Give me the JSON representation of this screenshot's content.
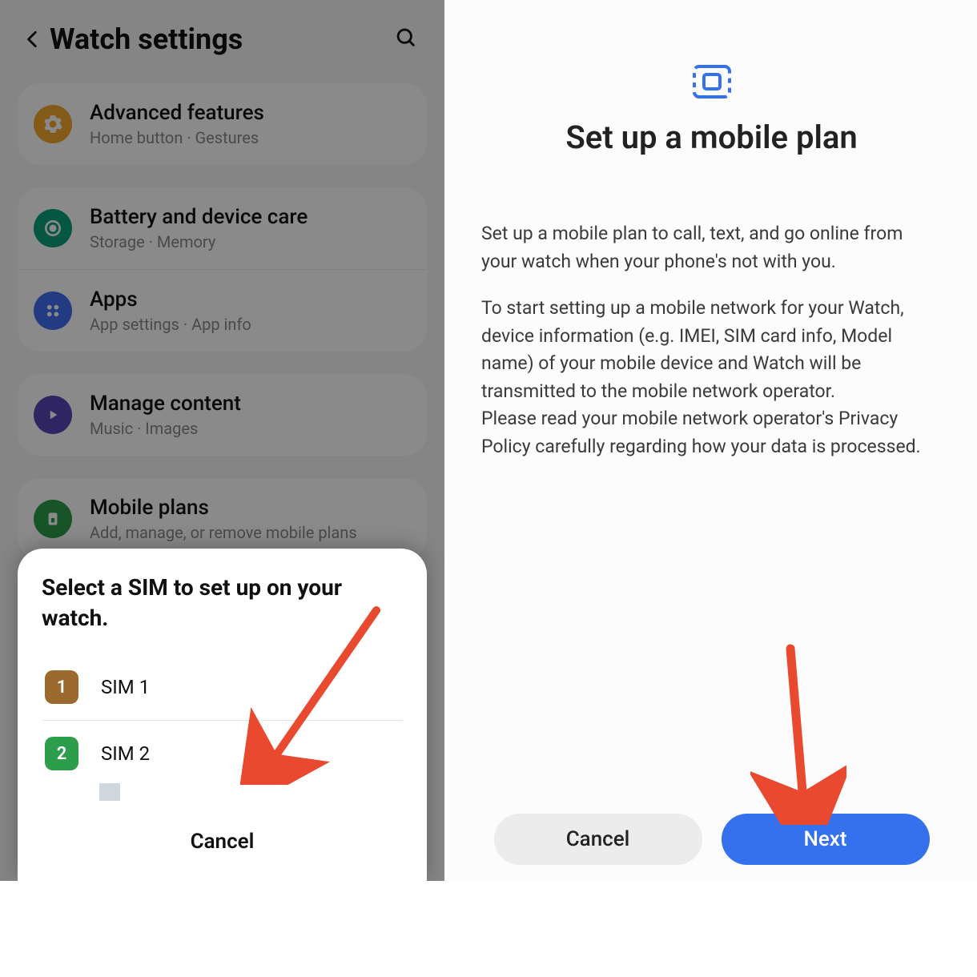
{
  "left": {
    "header": {
      "title": "Watch settings"
    },
    "groups": [
      {
        "items": [
          {
            "title": "Advanced features",
            "subtitle": "Home button  ·  Gestures",
            "icon": "gear-icon",
            "iconColor": "ic-orange"
          }
        ]
      },
      {
        "items": [
          {
            "title": "Battery and device care",
            "subtitle": "Storage  ·  Memory",
            "icon": "target-icon",
            "iconColor": "ic-teal"
          },
          {
            "title": "Apps",
            "subtitle": "App settings  ·  App info",
            "icon": "grid-icon",
            "iconColor": "ic-blue"
          }
        ]
      },
      {
        "items": [
          {
            "title": "Manage content",
            "subtitle": "Music  ·  Images",
            "icon": "play-icon",
            "iconColor": "ic-purple"
          }
        ]
      },
      {
        "items": [
          {
            "title": "Mobile plans",
            "subtitle": "Add, manage, or remove mobile plans",
            "icon": "sim-icon",
            "iconColor": "ic-green"
          }
        ]
      }
    ],
    "modal": {
      "title": "Select a SIM to set up on your watch.",
      "sims": [
        {
          "num": "1",
          "label": "SIM 1",
          "chipClass": "sim1"
        },
        {
          "num": "2",
          "label": "SIM 2",
          "chipClass": "sim2"
        }
      ],
      "cancel": "Cancel"
    }
  },
  "right": {
    "title": "Set up a mobile plan",
    "paragraph1": "Set up a mobile plan to call, text, and go online from your watch when your phone's not with you.",
    "paragraph2": "To start setting up a mobile network for your Watch, device information (e.g. IMEI, SIM card info, Model name) of your mobile device and Watch will be transmitted to the mobile network operator.\nPlease read your mobile network operator's Privacy Policy carefully regarding how your data is processed.",
    "buttons": {
      "cancel": "Cancel",
      "next": "Next"
    }
  },
  "colors": {
    "accentBlue": "#3571ed",
    "arrowRed": "#e8492f"
  }
}
